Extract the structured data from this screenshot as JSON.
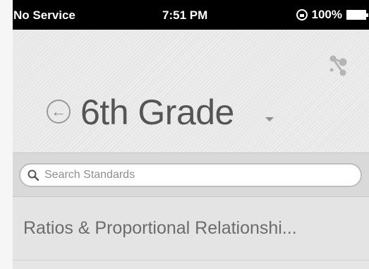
{
  "status_bar": {
    "carrier": "No Service",
    "time": "7:51 PM",
    "battery": "100%"
  },
  "header": {
    "title": "6th Grade"
  },
  "search": {
    "placeholder": "Search Standards"
  },
  "list": {
    "items": [
      {
        "label": "Ratios & Proportional Relationshi..."
      }
    ]
  }
}
